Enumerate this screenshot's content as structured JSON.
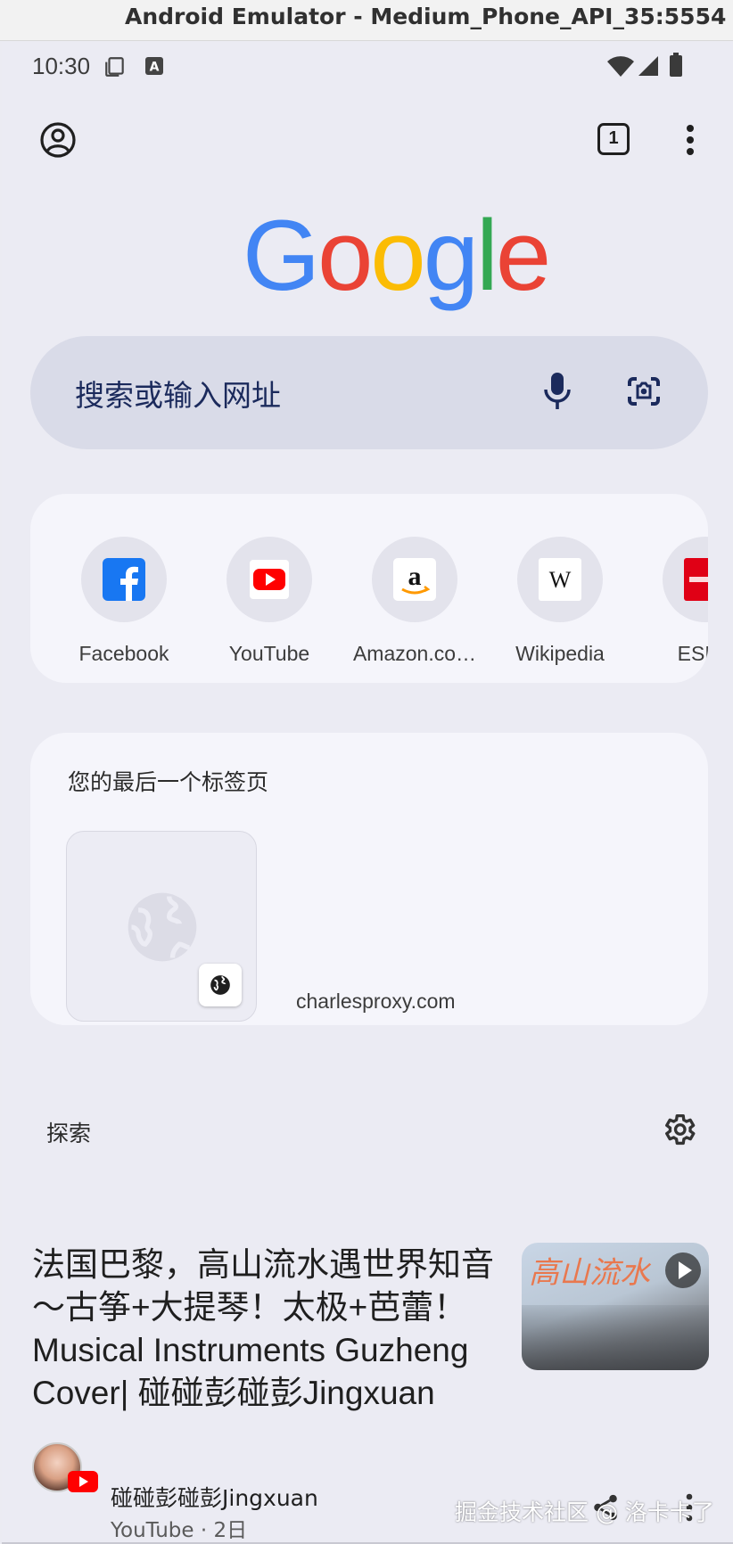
{
  "window": {
    "title": "Android Emulator - Medium_Phone_API_35:5554"
  },
  "status_bar": {
    "time": "10:30"
  },
  "toolbar": {
    "tab_count": "1"
  },
  "search": {
    "placeholder": "搜索或输入网址"
  },
  "shortcuts": [
    {
      "label": "Facebook",
      "icon": "facebook-icon"
    },
    {
      "label": "YouTube",
      "icon": "youtube-icon"
    },
    {
      "label": "Amazon.co…",
      "icon": "amazon-icon"
    },
    {
      "label": "Wikipedia",
      "icon": "wikipedia-icon"
    },
    {
      "label": "ESPN",
      "icon": "espn-icon"
    }
  ],
  "last_tab": {
    "heading": "您的最后一个标签页",
    "site": "charlesproxy.com"
  },
  "discover": {
    "heading": "探索",
    "article": {
      "title": "法国巴黎，高山流水遇世界知音～古筝+大提琴！太极+芭蕾！Musical Instruments Guzheng Cover| 碰碰彭碰彭Jingxuan",
      "author": "碰碰彭碰彭Jingxuan",
      "meta": "YouTube · 2日",
      "thumb_text": "高山流水"
    }
  },
  "watermark": "掘金技术社区 @ 洛卡卡了",
  "colors": {
    "google_blue": "#4285F4",
    "google_red": "#EA4335",
    "google_yellow": "#FBBC05",
    "google_green": "#34A853",
    "youtube_red": "#FF0000",
    "facebook_blue": "#1877F2"
  }
}
